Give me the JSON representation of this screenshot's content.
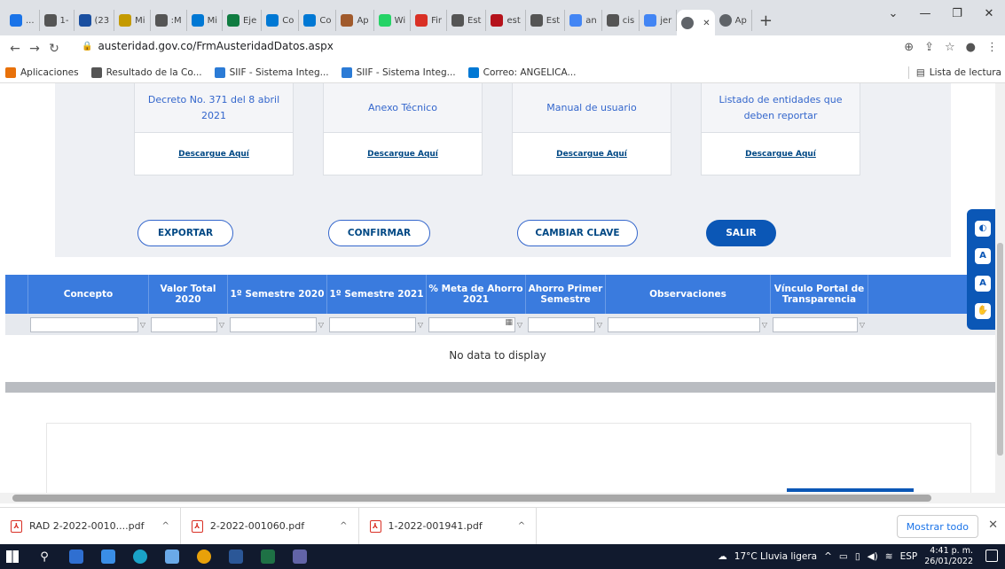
{
  "browser": {
    "tabs": [
      {
        "label": "...",
        "color": "#1a73e8"
      },
      {
        "label": "1-",
        "color": "#555"
      },
      {
        "label": "(23",
        "color": "#1a4fa0"
      },
      {
        "label": "Mi",
        "color": "#c49a00"
      },
      {
        "label": ":M",
        "color": "#555"
      },
      {
        "label": "Mi",
        "color": "#0078d4"
      },
      {
        "label": "Eje",
        "color": "#107c41"
      },
      {
        "label": "Co",
        "color": "#0078d4"
      },
      {
        "label": "Co",
        "color": "#0078d4"
      },
      {
        "label": "Ap",
        "color": "#a05a2c"
      },
      {
        "label": "Wi",
        "color": "#25d366"
      },
      {
        "label": "Fir",
        "color": "#d93025"
      },
      {
        "label": "Est",
        "color": "#555"
      },
      {
        "label": "est",
        "color": "#b5121b"
      },
      {
        "label": "Est",
        "color": "#555"
      },
      {
        "label": "an",
        "color": "#4285f4"
      },
      {
        "label": "cis",
        "color": "#555"
      },
      {
        "label": "jer",
        "color": "#4285f4"
      }
    ],
    "active_tab_label": "",
    "after_tab_label": "Ap",
    "url": "austeridad.gov.co/FrmAusteridadDatos.aspx",
    "bookmarks": [
      {
        "label": "Aplicaciones",
        "color": "#e8710a"
      },
      {
        "label": "Resultado de la Co...",
        "color": "#555"
      },
      {
        "label": "SIIF - Sistema Integ...",
        "color": "#2b7bd6"
      },
      {
        "label": "SIIF - Sistema Integ...",
        "color": "#2b7bd6"
      },
      {
        "label": "Correo: ANGELICA...",
        "color": "#0078d4"
      }
    ],
    "reading_list": "Lista de lectura"
  },
  "cards": [
    {
      "title": "Decreto No. 371 del 8 abril 2021",
      "link": "Descargue Aquí"
    },
    {
      "title": "Anexo Técnico",
      "link": "Descargue Aquí"
    },
    {
      "title": "Manual de usuario",
      "link": "Descargue Aquí"
    },
    {
      "title": "Listado de entidades que deben reportar",
      "link": "Descargue Aquí"
    }
  ],
  "actions": {
    "export": "EXPORTAR",
    "confirm": "CONFIRMAR",
    "change_password": "CAMBIAR CLAVE",
    "exit": "SALIR"
  },
  "grid": {
    "columns": [
      "",
      "Concepto",
      "Valor Total 2020",
      "1º Semestre 2020",
      "1º Semestre 2021",
      "% Meta de Ahorro 2021",
      "Ahorro Primer Semestre",
      "Observaciones",
      "Vínculo Portal de Transparencia"
    ],
    "empty_message": "No data to display"
  },
  "accessibility_widget": {
    "buttons": [
      "contrast-icon",
      "decrease-font-icon",
      "increase-font-icon",
      "sign-language-icon"
    ]
  },
  "downloads": {
    "items": [
      "RAD 2-2022-0010....pdf",
      "2-2022-001060.pdf",
      "1-2022-001941.pdf"
    ],
    "show_all": "Mostrar todo"
  },
  "taskbar": {
    "weather": "17°C  Lluvia ligera",
    "language": "ESP",
    "time": "4:41 p. m.",
    "date": "26/01/2022"
  }
}
